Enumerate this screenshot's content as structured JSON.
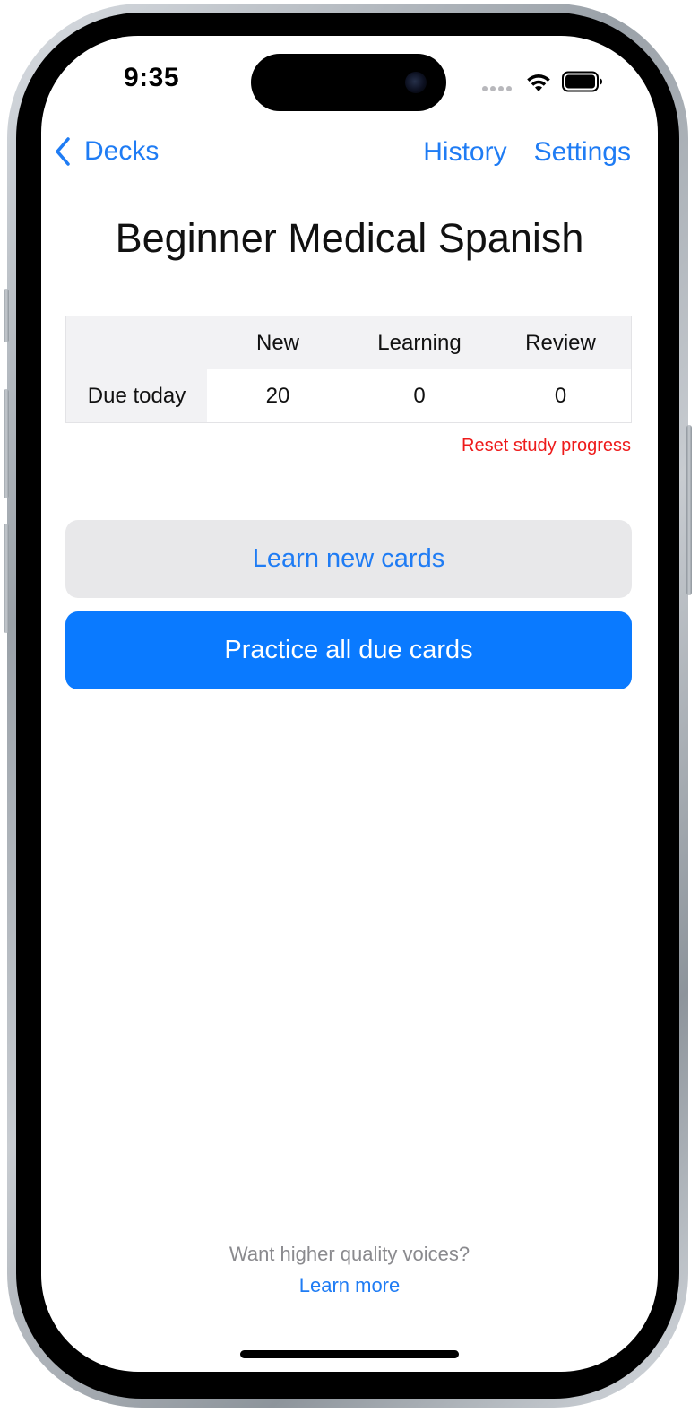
{
  "status_bar": {
    "time": "9:35"
  },
  "nav": {
    "back_label": "Decks",
    "history_label": "History",
    "settings_label": "Settings"
  },
  "deck": {
    "title": "Beginner Medical Spanish"
  },
  "stats": {
    "columns": [
      "New",
      "Learning",
      "Review"
    ],
    "row_label": "Due today",
    "values": {
      "new": "20",
      "learning": "0",
      "review": "0"
    },
    "colors": {
      "new": "#1f7cf4",
      "learning": "#ee1b1b",
      "review": "#2fb344"
    }
  },
  "reset_label": "Reset study progress",
  "actions": {
    "learn_new": "Learn new cards",
    "practice_due": "Practice all due cards"
  },
  "footer": {
    "prompt": "Want higher quality voices?",
    "link": "Learn more"
  },
  "theme": {
    "accent": "#1f7cf4",
    "primary_button": "#0a7aff",
    "secondary_button": "#e8e8ea",
    "danger": "#ee1b1b"
  }
}
